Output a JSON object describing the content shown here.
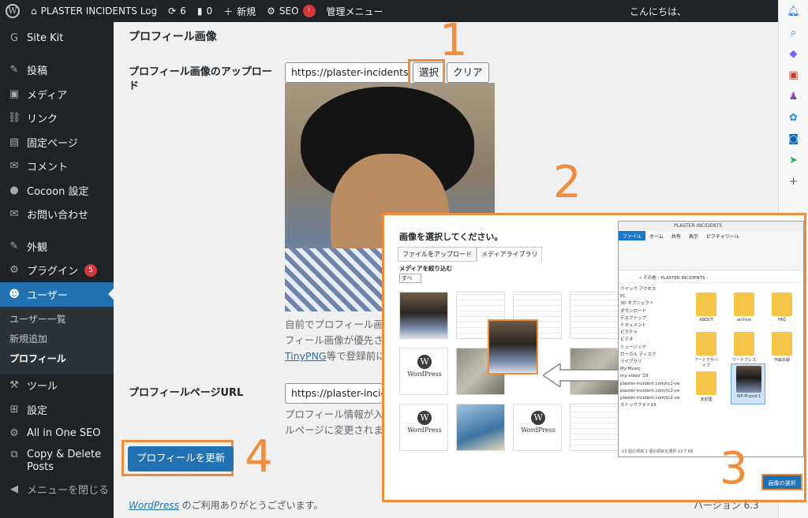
{
  "adminbar": {
    "site": "PLASTER INCIDENTS Log",
    "updates": "6",
    "comments": "0",
    "new": "新規",
    "seo": "SEO",
    "seo_badge": "!",
    "manage": "管理メニュー",
    "greeting": "こんにちは、"
  },
  "sidebar": {
    "items": [
      {
        "label": "Site Kit",
        "icon": "G"
      },
      {
        "label": "投稿",
        "icon": "✎"
      },
      {
        "label": "メディア",
        "icon": "▣"
      },
      {
        "label": "リンク",
        "icon": "⛓"
      },
      {
        "label": "固定ページ",
        "icon": "▤"
      },
      {
        "label": "コメント",
        "icon": "✉"
      },
      {
        "label": "Cocoon 設定",
        "icon": "●"
      },
      {
        "label": "お問い合わせ",
        "icon": "✉"
      },
      {
        "label": "外観",
        "icon": "✎"
      },
      {
        "label": "プラグイン",
        "icon": "⚙",
        "badge": "5"
      },
      {
        "label": "ユーザー",
        "icon": "☻"
      },
      {
        "label": "ツール",
        "icon": "⚒"
      },
      {
        "label": "設定",
        "icon": "⊞"
      },
      {
        "label": "All in One SEO",
        "icon": "⚙"
      },
      {
        "label": "Copy & Delete Posts",
        "icon": "⧉"
      },
      {
        "label": "メニューを閉じる",
        "icon": "◀"
      }
    ],
    "sub": [
      "ユーザー一覧",
      "新規追加",
      "プロフィール"
    ]
  },
  "main": {
    "section_title": "プロフィール画像",
    "upload_label": "プロフィール画像のアップロード",
    "upload_url": "https://plaster-incidents.c",
    "select_btn": "選択",
    "clear_btn": "クリア",
    "desc1": "自前でプロフィール画像",
    "desc2": "フィール画像が優先さ",
    "desc3_link": "TinyPNG",
    "desc3_rest": "等で登録前に",
    "page_url_label": "プロフィールページURL",
    "page_url": "https://plaster-inciden",
    "desc4": "プロフィール情報が入",
    "desc5": "ルページに変更されま",
    "update_btn": "プロフィールを更新",
    "footer_link": "WordPress",
    "footer_rest": " のご利用ありがとうございます。",
    "version": "バージョン 6.3"
  },
  "annotations": {
    "n1": "1",
    "n2": "2",
    "n3": "3",
    "n4": "4"
  },
  "modal": {
    "title": "画像を選択してください。",
    "tab_upload": "ファイルをアップロード",
    "tab_library": "メディアライブラリ",
    "filter_label": "メディアを絞り込む",
    "filter_value": "すべ",
    "wp_text": "WordPress",
    "select_image": "画像の選択"
  },
  "explorer": {
    "title": "PLASTER INCIDENTS",
    "tabs": [
      "ファイル",
      "ホーム",
      "共有",
      "表示",
      "ピクチャツール"
    ],
    "path": "« その他 › PLASTER INCIDENTS ›",
    "tree": [
      "クイック アクセス",
      "PC",
      "3D オブジェクト",
      "ダウンロード",
      "デスクトップ",
      "ドキュメント",
      "ピクチャ",
      "ビデオ",
      "ミュージック",
      "ローカル ディスク",
      "ライブラリ",
      "My Music",
      "my video '23",
      "plaster-incident.com/tc2-ve",
      "plaster-incident.com/tc2-ve",
      "plaster-incident.com/tc2-ve",
      "ストックフォト23"
    ],
    "folders": [
      "ABOUT",
      "archive",
      "FAQ",
      "アートでサバイブ",
      "ワードプレス導入者向け",
      "作曲本録",
      "未処理",
      "WP-Pl-prof-1"
    ],
    "status": "13 個の項目   1 個の項目を選択  13.7 KB"
  },
  "colors": {
    "accent": "#2271b1",
    "annotation": "#f08c3a",
    "adminbar": "#1d2327"
  }
}
